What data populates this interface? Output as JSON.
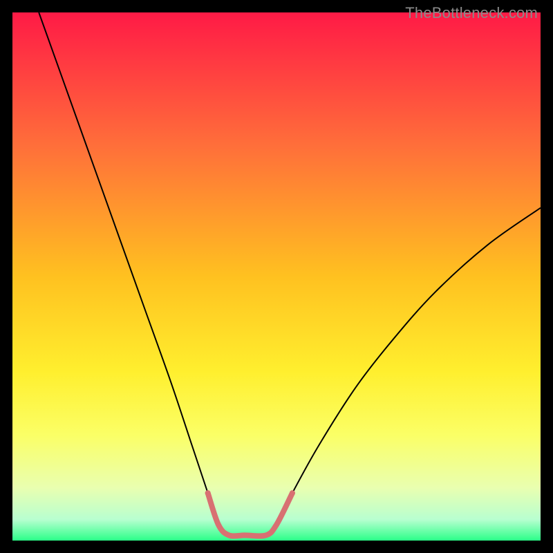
{
  "watermark": "TheBottleneck.com",
  "chart_data": {
    "type": "line",
    "title": "",
    "xlabel": "",
    "ylabel": "",
    "xlim": [
      0,
      100
    ],
    "ylim": [
      0,
      100
    ],
    "background": {
      "type": "vertical-gradient",
      "stops": [
        {
          "offset": 0,
          "color": "#ff1a46"
        },
        {
          "offset": 25,
          "color": "#ff6e3a"
        },
        {
          "offset": 50,
          "color": "#ffc120"
        },
        {
          "offset": 68,
          "color": "#ffef2e"
        },
        {
          "offset": 80,
          "color": "#fbff66"
        },
        {
          "offset": 90,
          "color": "#e9ffb0"
        },
        {
          "offset": 96,
          "color": "#b8ffd0"
        },
        {
          "offset": 100,
          "color": "#2bff88"
        }
      ]
    },
    "series": [
      {
        "name": "bottleneck-curve",
        "color": "#000000",
        "width": 2,
        "x": [
          5,
          10,
          15,
          20,
          25,
          30,
          34,
          37,
          39,
          41,
          44,
          48,
          50,
          53,
          58,
          65,
          72,
          80,
          90,
          100
        ],
        "y": [
          100,
          86,
          72,
          58,
          44,
          30,
          18,
          9,
          3,
          1,
          1,
          1,
          3,
          9,
          18,
          29,
          38,
          47,
          56,
          63
        ]
      },
      {
        "name": "optimal-marker",
        "color": "#d87072",
        "width": 8,
        "linecap": "round",
        "x": [
          37,
          39,
          41,
          44,
          48,
          50,
          53
        ],
        "y": [
          9,
          3,
          1,
          1,
          1,
          3,
          9
        ]
      }
    ]
  }
}
